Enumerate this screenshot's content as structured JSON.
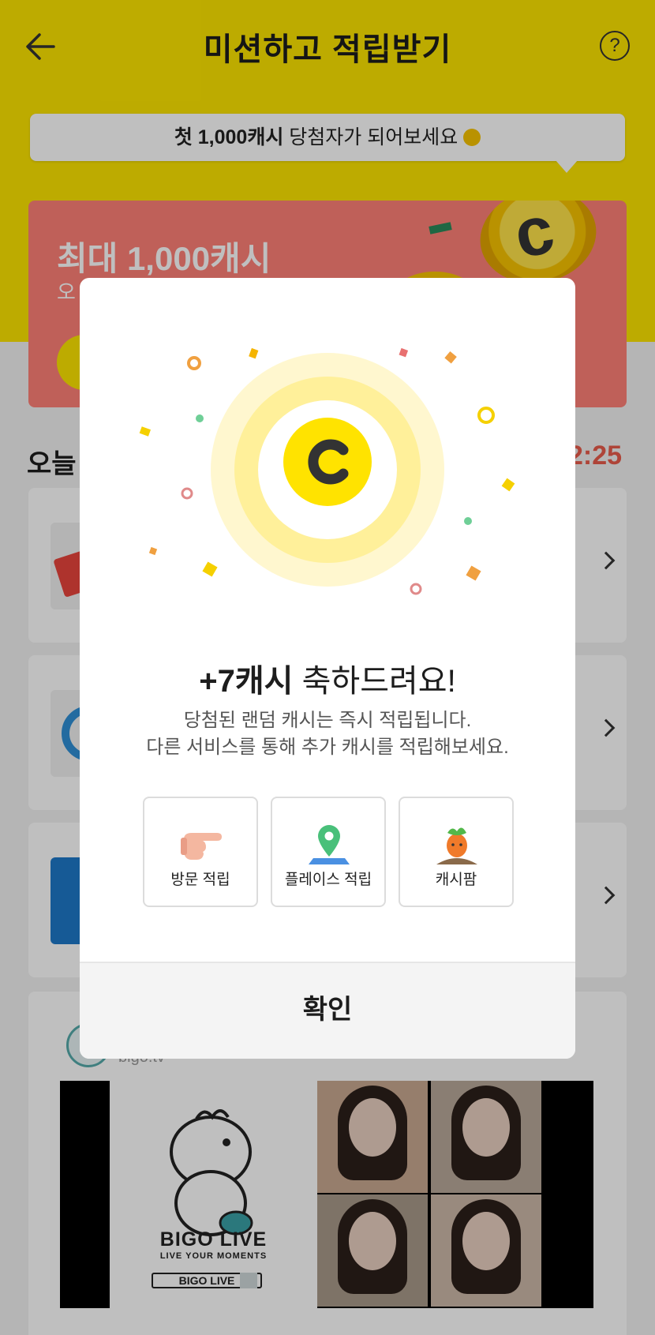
{
  "header": {
    "title": "미션하고 적립받기",
    "help_icon_text": "?"
  },
  "banner": {
    "bold": "첫 1,000캐시",
    "text": " 당첨자가 되어보세요 "
  },
  "promo": {
    "title": "최대 1,000캐시",
    "subtitle": "오"
  },
  "section": {
    "title": "오늘",
    "timer": "2:25"
  },
  "ad": {
    "domain": "bigo.tv",
    "brand": "BIGO LIVE",
    "tagline": "LIVE YOUR MOMENTS",
    "search_label": "BIGO LIVE"
  },
  "modal": {
    "title_bold": "+7캐시",
    "title_rest": " 축하드려요!",
    "desc_line1": "당첨된 랜덤 캐시는 즉시 적립됩니다.",
    "desc_line2": "다른 서비스를 통해 추가 캐시를 적립해보세요.",
    "options": [
      {
        "label": "방문 적립",
        "icon": "pointing-hand-icon"
      },
      {
        "label": "플레이스 적립",
        "icon": "map-pin-icon"
      },
      {
        "label": "캐시팜",
        "icon": "carrot-icon"
      }
    ],
    "confirm_label": "확인"
  },
  "colors": {
    "brand_yellow": "#fde500",
    "promo_red": "#ff8177",
    "timer_red": "#e85b4b"
  }
}
